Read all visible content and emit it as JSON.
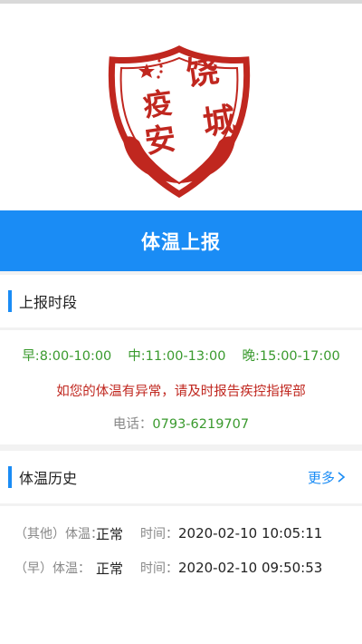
{
  "logo": {
    "chars": [
      "饶",
      "城",
      "疫",
      "安"
    ]
  },
  "report_button": {
    "label": "体温上报"
  },
  "period_section": {
    "title": "上报时段",
    "times": [
      "早:8:00-10:00",
      "中:11:00-13:00",
      "晚:15:00-17:00"
    ],
    "warning": "如您的体温有异常，请及时报告疾控指挥部",
    "phone_label": "电话：",
    "phone_number": "0793-6219707"
  },
  "history_section": {
    "title": "体温历史",
    "more_label": "更多",
    "records": [
      {
        "period_label": "（其他）体温：",
        "status": "正常",
        "time_label": "时间：",
        "time": "2020-02-10 10:05:11"
      },
      {
        "period_label": "（早）体温：",
        "status": "正常",
        "time_label": "时间：",
        "time": "2020-02-10 09:50:53"
      }
    ]
  },
  "colors": {
    "accent": "#1a8cf5",
    "logo_red": "#c0271f",
    "green": "#3a9a2e"
  }
}
